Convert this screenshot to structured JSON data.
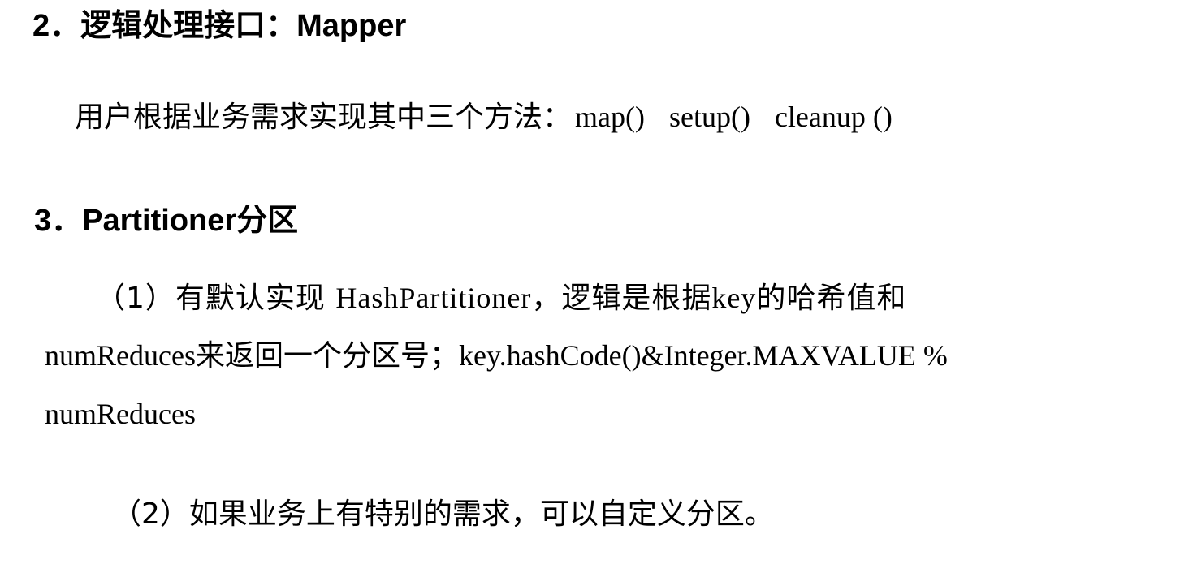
{
  "section2": {
    "heading": "2．逻辑处理接口：Mapper",
    "text_prefix": "用户根据业务需求实现其中三个方法：",
    "methods": [
      "map()",
      "setup()",
      "cleanup ()"
    ]
  },
  "section3": {
    "heading": "3．Partitioner分区",
    "item1": {
      "line1_a": "（1）有默认实现 ",
      "line1_b": "HashPartitioner",
      "line1_c": "，逻辑是根据",
      "line1_d": "key",
      "line1_e": "的哈希值和",
      "line2_a": "numReduces",
      "line2_b": "来返回一个分区号；",
      "line2_c": "key.hashCode()&Integer.MAXVALUE  %",
      "line3": "numReduces"
    },
    "item2": {
      "text": "（2）如果业务上有特别的需求，可以自定义分区。"
    }
  }
}
